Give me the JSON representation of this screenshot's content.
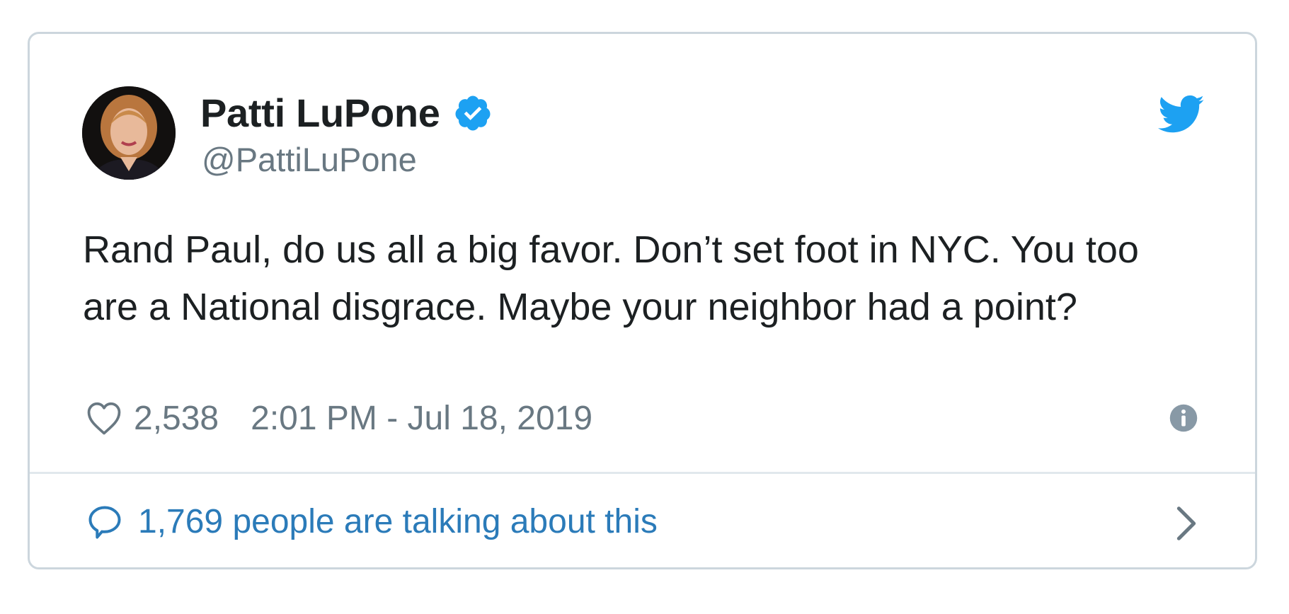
{
  "tweet": {
    "author": {
      "name": "Patti LuPone",
      "handle": "@PattiLuPone",
      "verified": true
    },
    "text": "Rand Paul, do us all a big favor. Don’t set foot in NYC. You too are a National disgrace. Maybe your neighbor had a point?",
    "likes": "2,538",
    "timestamp": "2:01 PM - Jul 18, 2019",
    "conversation": "1,769 people are talking about this"
  },
  "icons": {
    "brand": "twitter-bird-icon",
    "verified": "verified-badge-icon",
    "like": "heart-icon",
    "info": "info-icon",
    "reply": "speech-bubble-icon",
    "open": "chevron-right-icon"
  },
  "colors": {
    "twitter_blue": "#1da1f2",
    "link_blue": "#2b7bb9",
    "text": "#1c2022",
    "muted": "#697882",
    "border": "#ccd6dd"
  }
}
